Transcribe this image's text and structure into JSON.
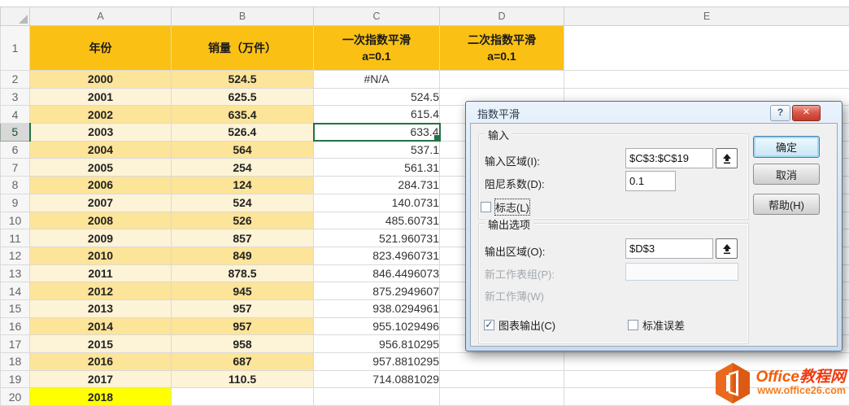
{
  "sheet": {
    "col_letters": [
      "A",
      "B",
      "C",
      "D",
      "E"
    ],
    "active_cell": {
      "col": "C",
      "row": 5,
      "value": "633.4"
    },
    "header_row": {
      "a": [
        "年份"
      ],
      "b": [
        "销量（万件）"
      ],
      "c": [
        "一次指数平滑",
        "a=0.1"
      ],
      "d": [
        "二次指数平滑",
        "a=0.1"
      ]
    },
    "rows": [
      {
        "n": 2,
        "a": "2000",
        "b": "524.5",
        "c": "#N/A"
      },
      {
        "n": 3,
        "a": "2001",
        "b": "625.5",
        "c": "524.5"
      },
      {
        "n": 4,
        "a": "2002",
        "b": "635.4",
        "c": "615.4"
      },
      {
        "n": 5,
        "a": "2003",
        "b": "526.4",
        "c": "633.4"
      },
      {
        "n": 6,
        "a": "2004",
        "b": "564",
        "c": "537.1"
      },
      {
        "n": 7,
        "a": "2005",
        "b": "254",
        "c": "561.31"
      },
      {
        "n": 8,
        "a": "2006",
        "b": "124",
        "c": "284.731"
      },
      {
        "n": 9,
        "a": "2007",
        "b": "524",
        "c": "140.0731"
      },
      {
        "n": 10,
        "a": "2008",
        "b": "526",
        "c": "485.60731"
      },
      {
        "n": 11,
        "a": "2009",
        "b": "857",
        "c": "521.960731"
      },
      {
        "n": 12,
        "a": "2010",
        "b": "849",
        "c": "823.4960731"
      },
      {
        "n": 13,
        "a": "2011",
        "b": "878.5",
        "c": "846.4496073"
      },
      {
        "n": 14,
        "a": "2012",
        "b": "945",
        "c": "875.2949607"
      },
      {
        "n": 15,
        "a": "2013",
        "b": "957",
        "c": "938.0294961"
      },
      {
        "n": 16,
        "a": "2014",
        "b": "957",
        "c": "955.1029496"
      },
      {
        "n": 17,
        "a": "2015",
        "b": "958",
        "c": "956.810295"
      },
      {
        "n": 18,
        "a": "2016",
        "b": "687",
        "c": "957.8810295"
      },
      {
        "n": 19,
        "a": "2017",
        "b": "110.5",
        "c": "714.0881029"
      },
      {
        "n": 20,
        "a": "2018",
        "b": "",
        "c": "",
        "a_highlight": true
      }
    ]
  },
  "dialog": {
    "title": "指数平滑",
    "titlebar": {
      "help": "?",
      "close": "✕"
    },
    "input_group": {
      "label": "输入",
      "input_range_label": "输入区域(I):",
      "input_range_value": "$C$3:$C$19",
      "damping_label": "阻尼系数(D):",
      "damping_value": "0.1",
      "labels_checkbox_label": "标志(L)"
    },
    "output_group": {
      "label": "输出选项",
      "output_range_label": "输出区域(O):",
      "output_range_value": "$D$3",
      "new_worksheet_label": "新工作表组(P):",
      "new_worksheet_value": "",
      "new_workbook_label": "新工作薄(W)",
      "chart_output_label": "图表输出(C)",
      "std_error_label": "标准误差"
    },
    "checkbox_states": {
      "labels": false,
      "chart_output": true,
      "std_error": false
    },
    "buttons": {
      "ok": "确定",
      "cancel": "取消",
      "help": "帮助(H)"
    }
  },
  "logo": {
    "brand_en": "Office",
    "brand_cn": "教程网",
    "url": "www.office26.com"
  },
  "colors": {
    "accent_green": "#217346",
    "header_gold": "#FAC014",
    "band_dark": "#FCE499",
    "band_light": "#FDF3D6",
    "highlight_yellow": "#FFFF00"
  }
}
